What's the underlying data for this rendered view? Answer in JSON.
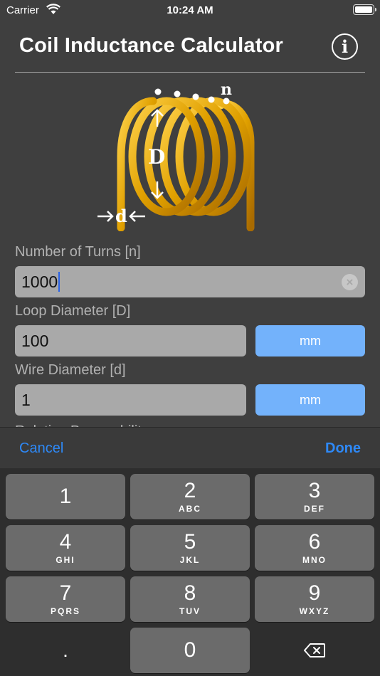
{
  "status_bar": {
    "carrier": "Carrier",
    "time": "10:24 AM"
  },
  "header": {
    "title": "Coil Inductance Calculator",
    "info_icon": "i"
  },
  "diagram": {
    "label_n": "n",
    "label_D": "D",
    "label_d": "d",
    "coil_color": "#e8a200"
  },
  "form": {
    "turns": {
      "label": "Number of Turns [n]",
      "value": "1000"
    },
    "loop_diameter": {
      "label": "Loop Diameter [D]",
      "value": "100",
      "unit": "mm"
    },
    "wire_diameter": {
      "label": "Wire Diameter [d]",
      "value": "1",
      "unit": "mm"
    },
    "permeability": {
      "label": "Relative Permeability"
    }
  },
  "toolbar": {
    "cancel_label": "Cancel",
    "done_label": "Done"
  },
  "keypad": {
    "k1": {
      "digit": "1",
      "letters": ""
    },
    "k2": {
      "digit": "2",
      "letters": "ABC"
    },
    "k3": {
      "digit": "3",
      "letters": "DEF"
    },
    "k4": {
      "digit": "4",
      "letters": "GHI"
    },
    "k5": {
      "digit": "5",
      "letters": "JKL"
    },
    "k6": {
      "digit": "6",
      "letters": "MNO"
    },
    "k7": {
      "digit": "7",
      "letters": "PQRS"
    },
    "k8": {
      "digit": "8",
      "letters": "TUV"
    },
    "k9": {
      "digit": "9",
      "letters": "WXYZ"
    },
    "k0": {
      "digit": "0"
    },
    "decimal": ".",
    "delete_icon": "backspace-icon"
  },
  "colors": {
    "accent": "#2e89f7",
    "unit_button": "#73b2fb",
    "background": "#3f3f3f",
    "input_bg": "#a9a9a9"
  }
}
